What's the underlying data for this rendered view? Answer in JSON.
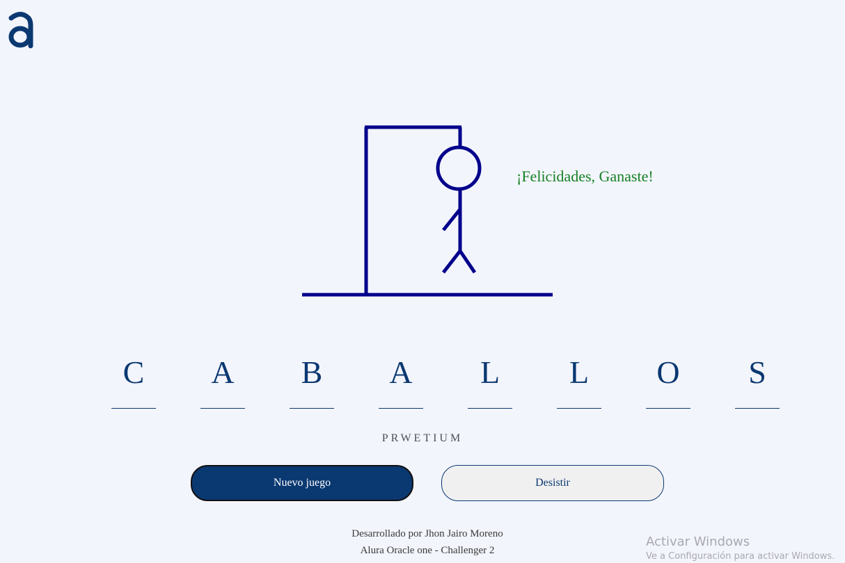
{
  "logo": {
    "icon": "alura-logo-icon",
    "color": "#0a3871"
  },
  "game": {
    "message": "¡Felicidades, Ganaste!",
    "message_color": "#158024",
    "word_letters": [
      "C",
      "A",
      "B",
      "A",
      "L",
      "L",
      "O",
      "S"
    ],
    "wrong_letters": "PRWETIUM",
    "drawing_color": "#00008b"
  },
  "buttons": {
    "new_game": "Nuevo juego",
    "give_up": "Desistir"
  },
  "footer": {
    "line1": "Desarrollado por Jhon Jairo Moreno",
    "line2": "Alura Oracle one - Challenger 2"
  },
  "os_watermark": {
    "title": "Activar Windows",
    "subtitle": "Ve a Configuración para activar Windows."
  },
  "colors": {
    "background": "#f3f5fc",
    "primary": "#0a3871"
  }
}
